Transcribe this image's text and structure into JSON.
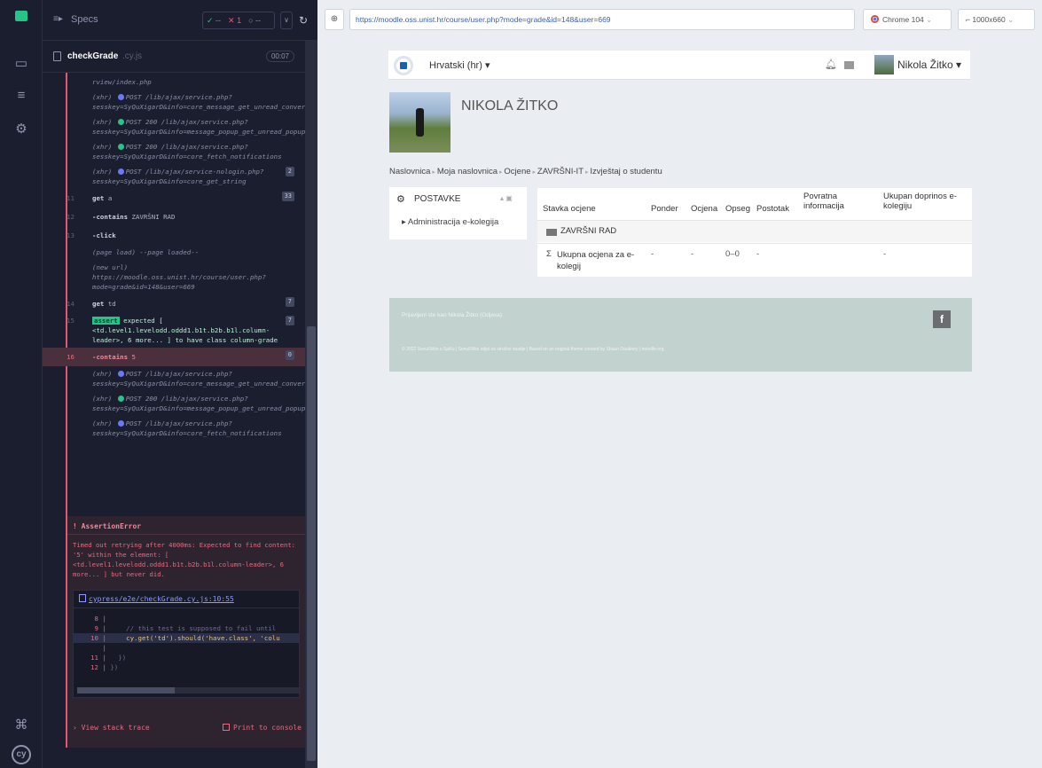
{
  "runner": {
    "specs_label": "Specs",
    "passed": "✓ --",
    "failed": "✕ 1",
    "pending": "○ --",
    "spec_name": "checkGrade",
    "spec_ext": ".cy.js",
    "duration": "00:07"
  },
  "commands": [
    {
      "type": "cont",
      "text": "rview/index.php"
    },
    {
      "type": "xhr",
      "dot": "#6b77ff",
      "text": "POST /lib/ajax/service.php?sesskey=SyQuXigarD&info=core_message_get_unread_conversations_count"
    },
    {
      "type": "xhr",
      "dot": "#27c48a",
      "text": "POST 200 /lib/ajax/service.php?sesskey=SyQuXigarD&info=message_popup_get_unread_popup_notification_count"
    },
    {
      "type": "xhr",
      "dot": "#27c48a",
      "text": "POST 200 /lib/ajax/service.php?sesskey=SyQuXigarD&info=core_fetch_notifications"
    },
    {
      "type": "xhr",
      "dot": "#6b77ff",
      "text": "POST /lib/ajax/service-nologin.php?sesskey=SyQuXigarD&info=core_get_string",
      "badge": "2"
    },
    {
      "type": "cmd",
      "num": "11",
      "name": "get",
      "arg": "a",
      "badge": "33"
    },
    {
      "type": "cmd",
      "num": "12",
      "name": "-contains",
      "arg": "ZAVRŠNI RAD"
    },
    {
      "type": "cmd",
      "num": "13",
      "name": "-click",
      "arg": ""
    },
    {
      "type": "note",
      "text": "(page load)  --page loaded--"
    },
    {
      "type": "note",
      "text": "(new url)  https://moodle.oss.unist.hr/course/user.php?mode=grade&id=148&user=669"
    },
    {
      "type": "cmd",
      "num": "14",
      "name": "get",
      "arg": "td",
      "badge": "7"
    },
    {
      "type": "assert",
      "num": "15",
      "label": "assert",
      "text": "expected [ <td.level1.levelodd.oddd1.b1t.b2b.b1l.column-leader>, 6 more... ] to have class column-grade",
      "badge": "7"
    },
    {
      "type": "fail",
      "num": "16",
      "name": "-contains",
      "arg": "5",
      "badge": "0"
    },
    {
      "type": "xhr",
      "dot": "#6b77ff",
      "text": "POST /lib/ajax/service.php?sesskey=SyQuXigarD&info=core_message_get_unread_conversations_count"
    },
    {
      "type": "xhr",
      "dot": "#27c48a",
      "text": "POST 200 /lib/ajax/service.php?sesskey=SyQuXigarD&info=message_popup_get_unread_popup_notification_count"
    },
    {
      "type": "xhr",
      "dot": "#6b77ff",
      "text": "POST /lib/ajax/service.php?sesskey=SyQuXigarD&info=core_fetch_notifications"
    }
  ],
  "error": {
    "title": "AssertionError",
    "message": "Timed out retrying after 4000ms: Expected to find content: '5' within the element: [ <td.level1.levelodd.oddd1.b1t.b2b.b1l.column-leader>, 6 more... ] but never did.",
    "file": "cypress/e2e/checkGrade.cy.js:10:55",
    "code": [
      {
        "n": "8",
        "t": ""
      },
      {
        "n": "9",
        "t": "    // this test is supposed to fail until"
      },
      {
        "n": "10",
        "t": "    cy.get('td').should('have.class', 'colu"
      },
      {
        "n": "",
        "t": ""
      },
      {
        "n": "11",
        "t": "  })"
      },
      {
        "n": "12",
        "t": "})"
      }
    ],
    "stack": "View stack trace",
    "print": "Print to console"
  },
  "browser": {
    "url": "https://moodle.oss.unist.hr/course/user.php?mode=grade&id=148&user=669",
    "browser_name": "Chrome 104",
    "viewport": "1000x660"
  },
  "moodle": {
    "language": "Hrvatski (hr)",
    "user": "Nikola Žitko",
    "heading": "NIKOLA ŽITKO",
    "breadcrumb": [
      "Naslovnica",
      "Moja naslovnica",
      "Ocjene",
      "ZAVRŠNI-IT",
      "Izvještaj o studentu"
    ],
    "settings_title": "POSTAVKE",
    "settings_item": "Administracija e-kolegija",
    "table_headers": [
      "Stavka ocjene",
      "Ponder",
      "Ocjena",
      "Opseg",
      "Postotak",
      "Povratna informacija",
      "Ukupan doprinos e-kolegiju"
    ],
    "category": "ZAVRŠNI RAD",
    "total_row": {
      "label": "Ukupna ocjena za e-kolegij",
      "ponder": "-",
      "ocjena": "-",
      "opseg": "0–0",
      "postotak": "-",
      "povratna": "",
      "doprinos": "-"
    },
    "footer_login": "Prijavljeni ste kao Nikola Žitko (Odjava)",
    "footer_copy": "© 2022 Sveučilište u Splitu | Sveučilišni odjel za stručne studije | Based on an original theme created by Shaun Daubney | moodle.org",
    "colors": {
      "footer": "#c2d2cf",
      "reporter": "#1b1e2e",
      "error": "#e45770"
    }
  }
}
